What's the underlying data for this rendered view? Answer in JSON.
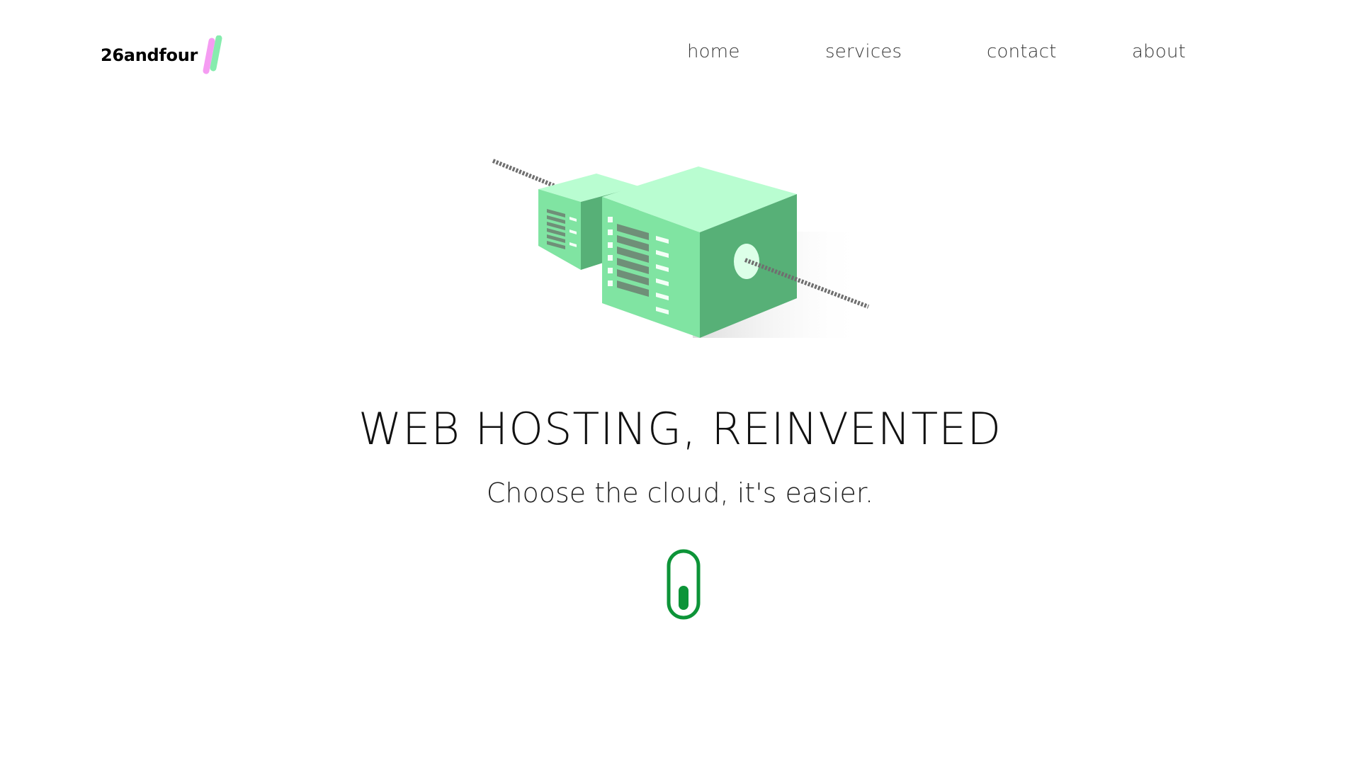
{
  "header": {
    "logo_text": "26andfour",
    "logo_colors": {
      "pink": "#f59cf2",
      "green": "#86ecae"
    },
    "nav": [
      {
        "id": "home",
        "label": "home"
      },
      {
        "id": "services",
        "label": "services"
      },
      {
        "id": "contact",
        "label": "contact"
      },
      {
        "id": "about",
        "label": "about"
      }
    ]
  },
  "hero": {
    "illustration": "server-cubes-illustration",
    "title": "WEB HOSTING, REINVENTED",
    "subtitle": "Choose the cloud, it's easier.",
    "scroll_icon": "mouse-scroll-icon"
  },
  "colors": {
    "server_top": "#b9fdd1",
    "server_front": "#80e4a2",
    "server_side": "#57b077",
    "scroll_accent": "#0d9438",
    "nav_text": "#3a3a3a"
  }
}
